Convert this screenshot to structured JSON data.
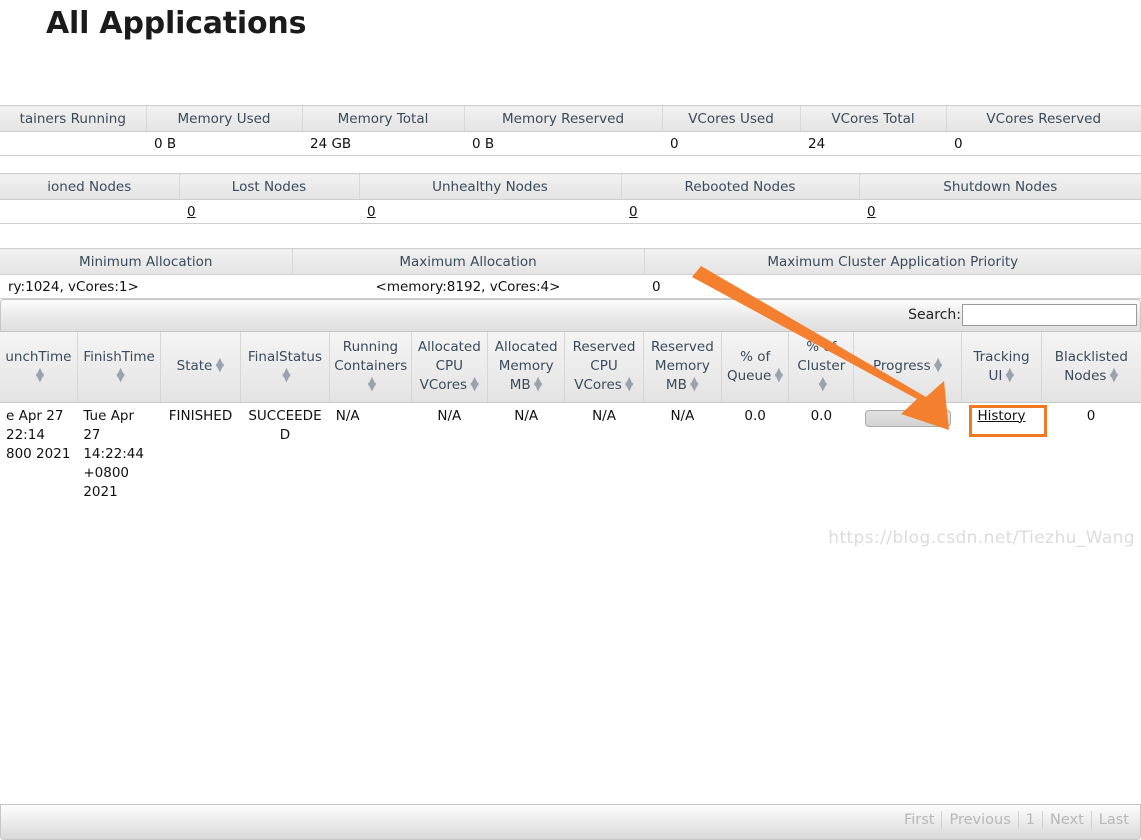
{
  "page": {
    "title": "All Applications",
    "watermark": "https://blog.csdn.net/Tiezhu_Wang",
    "accent_color": "#f07a22",
    "header_text_color": "#3b4a5a"
  },
  "cluster_metrics": {
    "headers": [
      "tainers Running",
      "Memory Used",
      "Memory Total",
      "Memory Reserved",
      "VCores Used",
      "VCores Total",
      "VCores Reserved"
    ],
    "values": [
      "",
      "0 B",
      "24 GB",
      "0 B",
      "0",
      "24",
      "0"
    ]
  },
  "node_metrics": {
    "headers": [
      "ioned Nodes",
      "Lost Nodes",
      "Unhealthy Nodes",
      "Rebooted Nodes",
      "Shutdown Nodes"
    ],
    "values": [
      "",
      "0",
      "0",
      "0",
      "0"
    ]
  },
  "scheduler_metrics": {
    "headers": [
      "Minimum Allocation",
      "Maximum Allocation",
      "Maximum Cluster Application Priority"
    ],
    "values": [
      "ry:1024, vCores:1>",
      "<memory:8192, vCores:4>",
      "0"
    ]
  },
  "apps_panel": {
    "search": {
      "label": "Search:",
      "value": "",
      "placeholder": ""
    },
    "columns": [
      {
        "label": "unchTime",
        "sortable": true
      },
      {
        "label": "FinishTime",
        "sortable": true
      },
      {
        "label": "State",
        "sortable": true
      },
      {
        "label": "FinalStatus",
        "sortable": true
      },
      {
        "label": "Running Containers",
        "sortable": true
      },
      {
        "label": "Allocated CPU VCores",
        "sortable": true
      },
      {
        "label": "Allocated Memory MB",
        "sortable": true
      },
      {
        "label": "Reserved CPU VCores",
        "sortable": true
      },
      {
        "label": "Reserved Memory MB",
        "sortable": true
      },
      {
        "label": "% of Queue",
        "sortable": true
      },
      {
        "label": "% of Cluster",
        "sortable": true
      },
      {
        "label": "Progress",
        "sortable": true
      },
      {
        "label": "Tracking UI",
        "sortable": true
      },
      {
        "label": "Blacklisted Nodes",
        "sortable": true
      }
    ],
    "rows": [
      {
        "launch_time": "e Apr 27 22:14 800 2021",
        "finish_time": "Tue Apr 27 14:22:44 +0800 2021",
        "state": "FINISHED",
        "final_status": "SUCCEEDED",
        "running_containers": "N/A",
        "allocated_cpu_vcores": "N/A",
        "allocated_memory_mb": "N/A",
        "reserved_cpu_vcores": "N/A",
        "reserved_memory_mb": "N/A",
        "pct_of_queue": "0.0",
        "pct_of_cluster": "0.0",
        "progress": "",
        "tracking_ui": "History",
        "blacklisted_nodes": "0"
      }
    ],
    "pagination": [
      "First",
      "Previous",
      "1",
      "Next",
      "Last"
    ]
  }
}
